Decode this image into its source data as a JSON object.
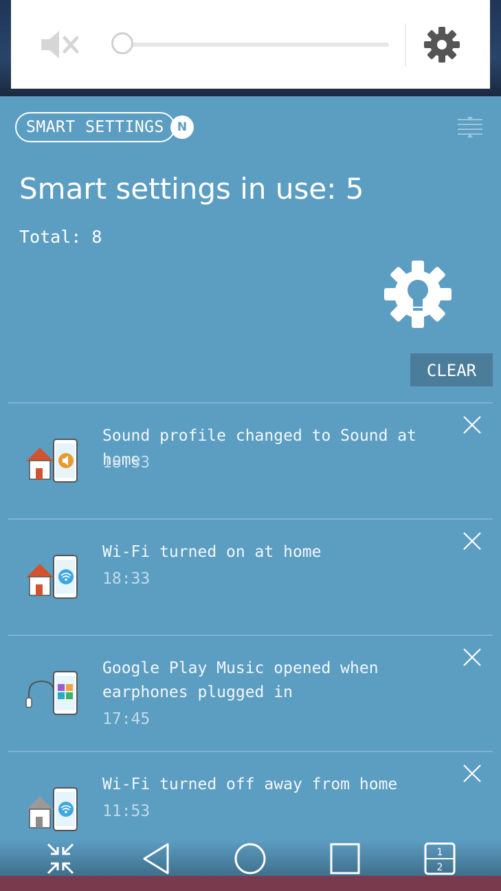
{
  "volume": {
    "icon": "speaker-muted-icon",
    "level_percent": 0,
    "settings_icon": "gear-icon"
  },
  "header": {
    "smart_settings_label": "SMART SETTINGS",
    "badge": "N",
    "filter_icon": "filter-lines-icon"
  },
  "summary": {
    "in_use_text": "Smart settings in use:  5",
    "total_text": "Total:  8"
  },
  "clear_label": "CLEAR",
  "notifications": [
    {
      "message": "Sound profile changed to Sound at home",
      "time": "18:33",
      "icon": "home-sound-icon"
    },
    {
      "message": "Wi-Fi turned on at home",
      "time": "18:33",
      "icon": "home-wifi-icon"
    },
    {
      "message": "Google Play Music opened when earphones plugged in",
      "time": "17:45",
      "icon": "earphones-apps-icon"
    },
    {
      "message": "Wi-Fi turned off away from home",
      "time": "11:53",
      "icon": "away-wifi-icon"
    }
  ],
  "nav": {
    "buttons": [
      "minimize-arrows-icon",
      "back-icon",
      "home-icon",
      "recents-icon",
      "dual-window-icon"
    ],
    "dual_window_top": "1",
    "dual_window_bottom": "2"
  },
  "colors": {
    "panel": "#5c9dc2",
    "clear_button": "#4b7d9a",
    "house_roof": "#d2542e",
    "sound_badge": "#e79a2e",
    "wifi_badge": "#3fa6e0"
  }
}
